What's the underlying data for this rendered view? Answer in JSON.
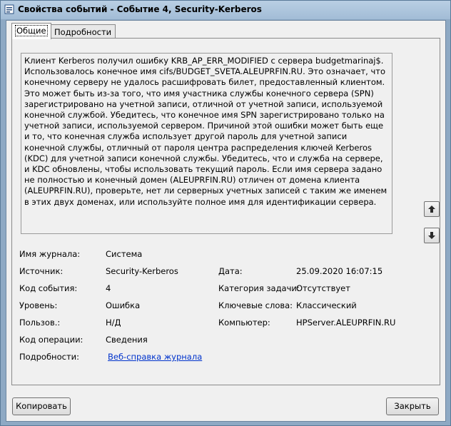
{
  "window": {
    "title": "Свойства событий - Событие 4, Security-Kerberos"
  },
  "tabs": [
    {
      "label": "Общие"
    },
    {
      "label": "Подробности"
    }
  ],
  "description": "Клиент Kerberos получил ошибку KRB_AP_ERR_MODIFIED с сервера budgetmarinaj$. Использовалось конечное имя cifs/BUDGET_SVETA.ALEUPRFIN.RU. Это означает, что конечному серверу не удалось расшифровать билет, предоставленный клиентом. Это может быть из-за того, что имя участника службы конечного сервера (SPN) зарегистрировано на учетной записи, отличной от учетной записи, используемой конечной службой. Убедитесь, что конечное имя SPN зарегистрировано только на учетной записи, используемой сервером. Причиной этой ошибки может быть еще и то, что конечная служба использует другой пароль для учетной записи конечной службы, отличный от пароля центра распределения ключей Kerberos (KDC) для учетной записи конечной службы. Убедитесь, что и служба на сервере, и KDC обновлены, чтобы использовать текущий пароль. Если имя сервера задано не полностью и конечный домен (ALEUPRFIN.RU) отличен от домена клиента (ALEUPRFIN.RU), проверьте, нет ли серверных учетных записей с таким же именем в этих двух доменах, или используйте полное имя для идентификации сервера.",
  "fields": {
    "log_name": {
      "label": "Имя журнала:",
      "value": "Система"
    },
    "source": {
      "label": "Источник:",
      "value": "Security-Kerberos"
    },
    "date": {
      "label": "Дата:",
      "value": "25.09.2020 16:07:15"
    },
    "event_id": {
      "label": "Код события:",
      "value": "4"
    },
    "task_category": {
      "label": "Категория задачи:",
      "value": "Отсутствует"
    },
    "level": {
      "label": "Уровень:",
      "value": "Ошибка"
    },
    "keywords": {
      "label": "Ключевые слова:",
      "value": "Классический"
    },
    "user": {
      "label": "Пользов.:",
      "value": "Н/Д"
    },
    "computer": {
      "label": "Компьютер:",
      "value": "HPServer.ALEUPRFIN.RU"
    },
    "opcode": {
      "label": "Код операции:",
      "value": "Сведения"
    },
    "more_info": {
      "label": "Подробности:",
      "value": "Веб-справка журнала"
    }
  },
  "buttons": {
    "copy": "Копировать",
    "close": "Закрыть"
  },
  "icons": {
    "title": "event-viewer-icon",
    "up": "arrow-up-icon",
    "down": "arrow-down-icon"
  }
}
